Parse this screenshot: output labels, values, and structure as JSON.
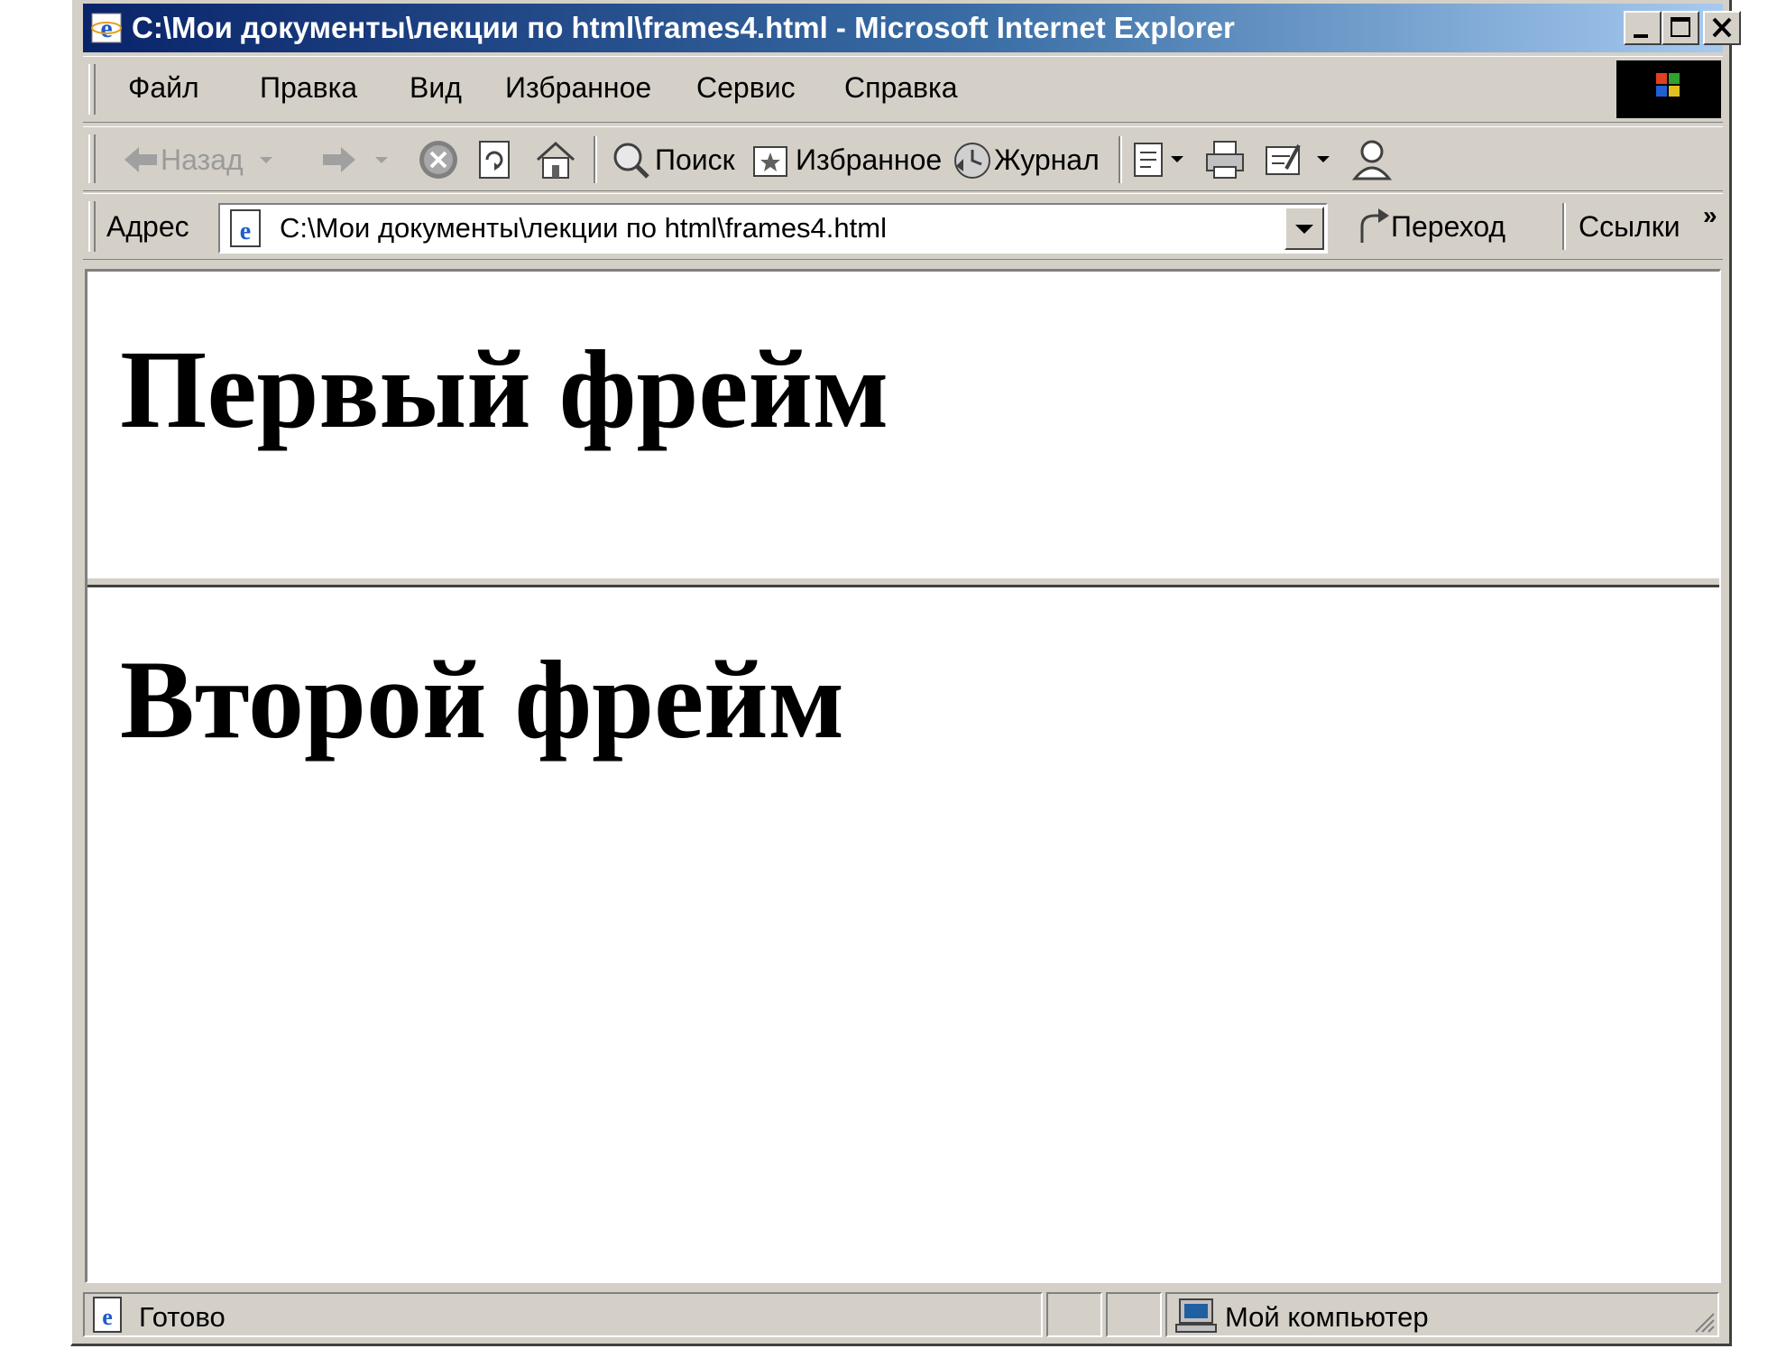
{
  "window": {
    "title": "C:\\Мои документы\\лекции по html\\frames4.html - Microsoft Internet Explorer"
  },
  "menu": {
    "items": [
      {
        "label": "Файл"
      },
      {
        "label": "Правка"
      },
      {
        "label": "Вид"
      },
      {
        "label": "Избранное"
      },
      {
        "label": "Сервис"
      },
      {
        "label": "Справка"
      }
    ]
  },
  "toolbar": {
    "back_label": "Назад",
    "search_label": "Поиск",
    "favorites_label": "Избранное",
    "history_label": "Журнал"
  },
  "addressbar": {
    "label": "Адрес",
    "value": "C:\\Мои документы\\лекции по html\\frames4.html",
    "go_label": "Переход",
    "links_label": "Ссылки",
    "more": "»"
  },
  "frames": {
    "first_heading": "Первый фрейм",
    "second_heading": "Второй фрейм"
  },
  "statusbar": {
    "status": "Готово",
    "zone": "Мой компьютер"
  },
  "colors": {
    "titlebar_start": "#0a246a",
    "titlebar_end": "#a6caf0",
    "chrome": "#d4d0c8"
  }
}
